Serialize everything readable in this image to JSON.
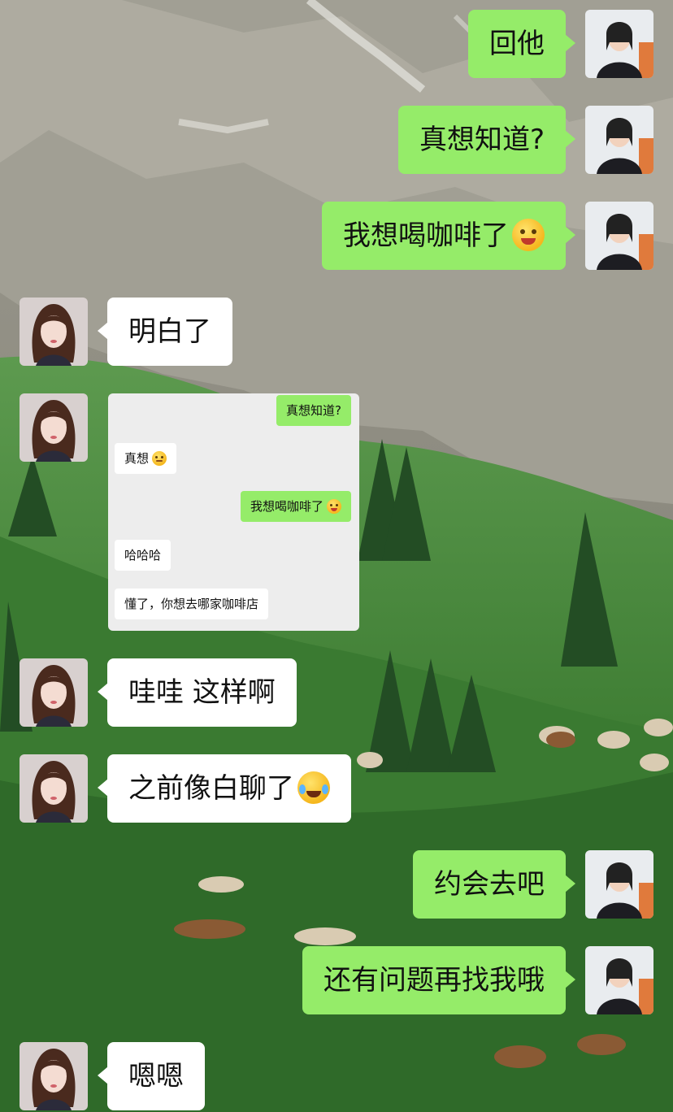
{
  "colors": {
    "sent_bubble": "#95EC69",
    "received_bubble": "#FFFFFF",
    "screenshot_bg": "#EDEDED"
  },
  "messages": [
    {
      "side": "right",
      "text": "回他"
    },
    {
      "side": "right",
      "text": "真想知道?"
    },
    {
      "side": "right",
      "text": "我想喝咖啡了",
      "emoji": "drooling-face-icon"
    },
    {
      "side": "left",
      "text": "明白了"
    },
    {
      "side": "left",
      "type": "image",
      "text": "[聊天截图]"
    },
    {
      "side": "left",
      "text": "哇哇 这样啊"
    },
    {
      "side": "left",
      "text": "之前像白聊了",
      "emoji": "crying-laughing-face-icon"
    },
    {
      "side": "right",
      "text": "约会去吧"
    },
    {
      "side": "right",
      "text": "还有问题再找我哦"
    },
    {
      "side": "left",
      "text": "嗯嗯"
    }
  ],
  "screenshot": {
    "messages": [
      {
        "side": "right",
        "text": "真想知道?"
      },
      {
        "side": "left",
        "text": "真想",
        "emoji": "blushing-face-icon"
      },
      {
        "side": "right",
        "text": "我想喝咖啡了",
        "emoji": "drooling-face-icon"
      },
      {
        "side": "left",
        "text": "哈哈哈"
      },
      {
        "side": "left",
        "text": "懂了，你想去哪家咖啡店"
      }
    ]
  }
}
